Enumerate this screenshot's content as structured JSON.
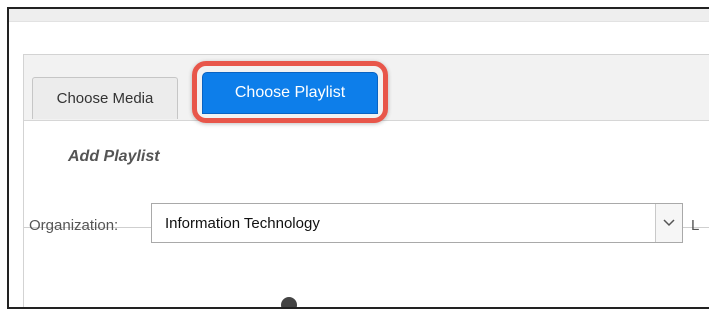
{
  "tabs": {
    "choose_media": "Choose Media",
    "choose_playlist": "Choose Playlist"
  },
  "section": {
    "add_playlist": "Add Playlist"
  },
  "form": {
    "organization_label": "Organization:",
    "organization_value": "Information Technology",
    "truncated_next_label": "L"
  },
  "colors": {
    "active_tab": "#0d7eea",
    "highlight_ring": "#e8564a"
  },
  "icons": {
    "select_toggle": "chevron-down-icon"
  }
}
